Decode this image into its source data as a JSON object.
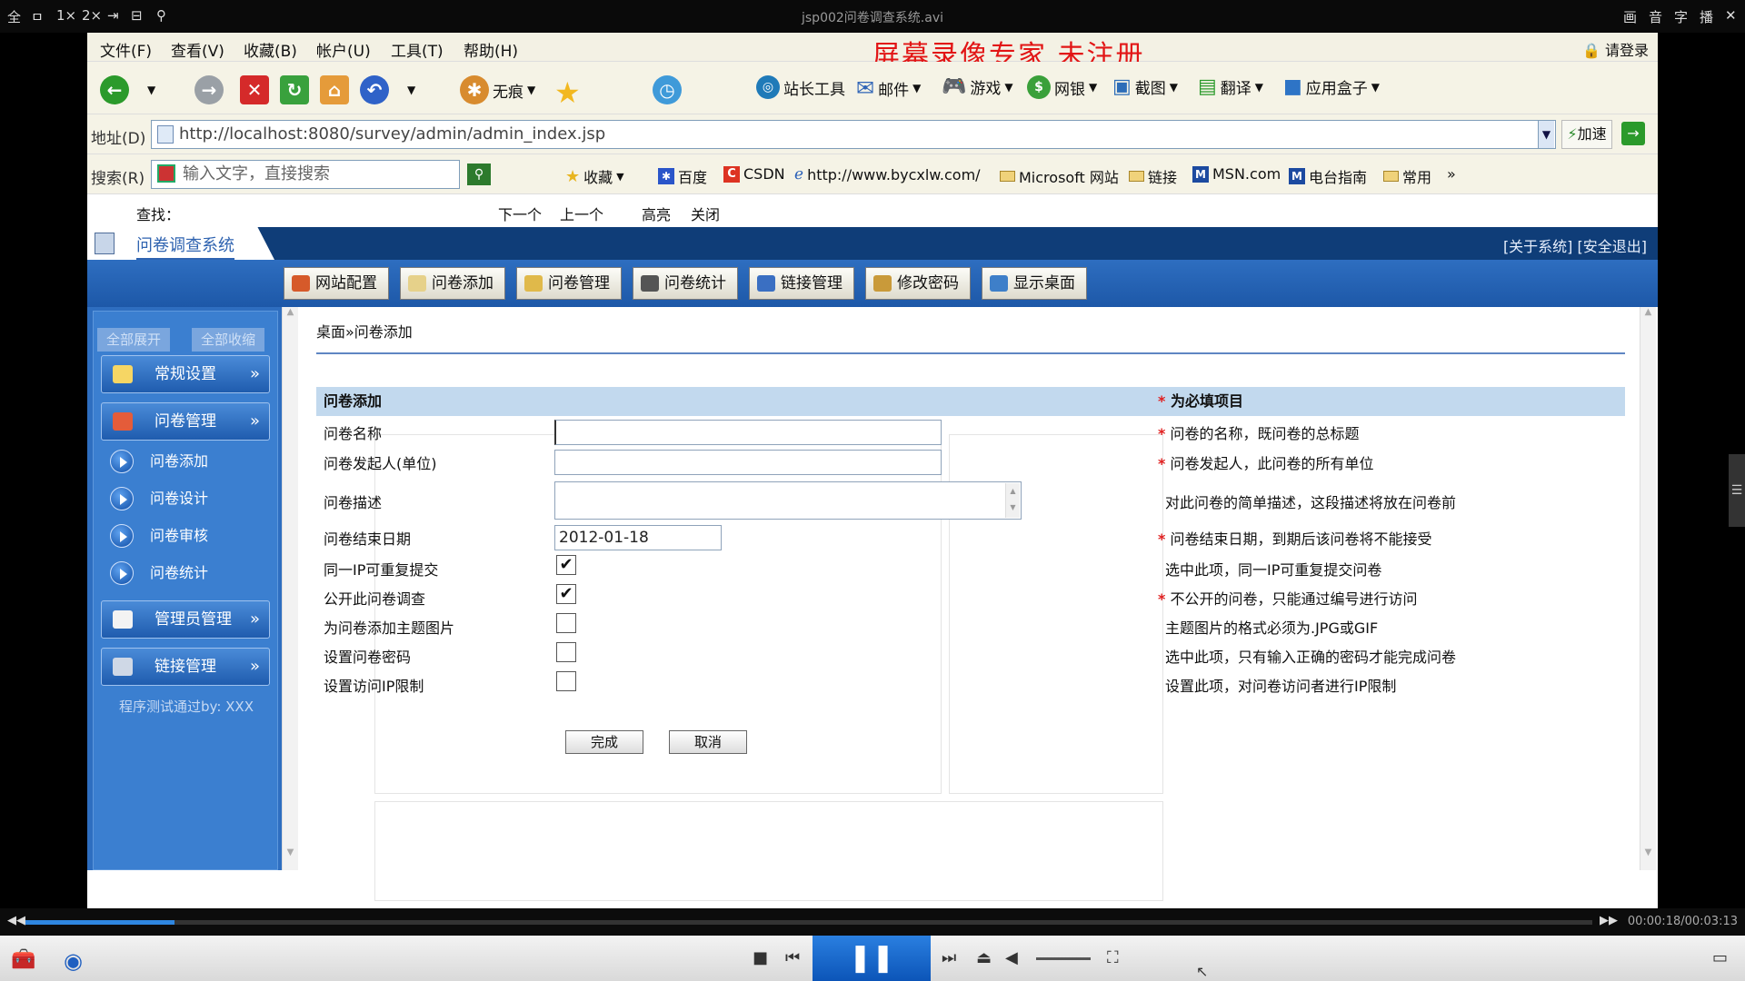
{
  "player": {
    "title": "jsp002问卷调查系统.avi",
    "left_controls": [
      "全",
      "ㅁ",
      "1×",
      "2×",
      "⇥",
      "⊟",
      "⚲"
    ],
    "right_controls": [
      "画",
      "音",
      "字",
      "播",
      "✕"
    ],
    "time": "00:00:18/00:03:13",
    "progress_fraction": 0.095
  },
  "browser": {
    "menus": [
      "文件(F)",
      "查看(V)",
      "收藏(B)",
      "帐户(U)",
      "工具(T)",
      "帮助(H)"
    ],
    "watermark": "屏幕录像专家   未注册",
    "login": "请登录",
    "toolbar": {
      "incognito": "无痕",
      "webmaster": "站长工具",
      "mail": "邮件",
      "games": "游戏",
      "netbank": "网银",
      "screenshot": "截图",
      "translate": "翻译",
      "appbox": "应用盒子"
    },
    "address_label": "地址(D)",
    "url": "http://localhost:8080/survey/admin/admin_index.jsp",
    "speedup": "加速",
    "search_label": "搜索(R)",
    "search_placeholder": "输入文字，直接搜索",
    "favorites": [
      "收藏",
      "百度",
      "CSDN",
      "http://www.bycxlw.com/",
      "Microsoft 网站",
      "链接",
      "MSN.com",
      "电台指南",
      "常用"
    ],
    "more": "»",
    "find": {
      "label": "查找：",
      "next": "下一个",
      "prev": "上一个",
      "highlight": "高亮",
      "close": "关闭"
    }
  },
  "app": {
    "title": "问卷调查系统",
    "header_links": "[关于系统] [安全退出]",
    "nav": [
      "网站配置",
      "问卷添加",
      "问卷管理",
      "问卷统计",
      "链接管理",
      "修改密码",
      "显示桌面"
    ],
    "sidebar": {
      "expand_all": "全部展开",
      "collapse_all": "全部收缩",
      "sections": [
        "常规设置",
        "问卷管理",
        "管理员管理",
        "链接管理"
      ],
      "items": [
        "问卷添加",
        "问卷设计",
        "问卷审核",
        "问卷统计"
      ],
      "footer": "程序测试通过by: XXX"
    },
    "breadcrumb": "桌面»问卷添加",
    "form": {
      "title": "问卷添加",
      "required_note": "为必填项目",
      "rows": [
        {
          "label": "问卷名称",
          "value": "",
          "required": true,
          "hint": "问卷的名称，既问卷的总标题"
        },
        {
          "label": "问卷发起人(单位)",
          "value": "",
          "required": true,
          "hint": "问卷发起人，此问卷的所有单位"
        },
        {
          "label": "问卷描述",
          "value": "",
          "required": false,
          "hint": "对此问卷的简单描述，这段描述将放在问卷前"
        },
        {
          "label": "问卷结束日期",
          "value": "2012-01-18",
          "required": true,
          "hint": "问卷结束日期，到期后该问卷将不能接受"
        },
        {
          "label": "同一IP可重复提交",
          "checked": true,
          "required": false,
          "hint": "选中此项，同一IP可重复提交问卷"
        },
        {
          "label": "公开此问卷调查",
          "checked": true,
          "required": true,
          "hint": "不公开的问卷，只能通过编号进行访问"
        },
        {
          "label": "为问卷添加主题图片",
          "checked": false,
          "required": false,
          "hint": "主题图片的格式必须为.JPG或GIF"
        },
        {
          "label": "设置问卷密码",
          "checked": false,
          "required": false,
          "hint": "选中此项，只有输入正确的密码才能完成问卷"
        },
        {
          "label": "设置访问IP限制",
          "checked": false,
          "required": false,
          "hint": "设置此项，对问卷访问者进行IP限制"
        }
      ],
      "submit": "完成",
      "cancel": "取消"
    }
  },
  "colors": {
    "header_blue": "#0f3d78",
    "nav_blue": "#2e6ec0",
    "form_header": "#c2d9ee",
    "required_star": "#e01f1f",
    "watermark": "#e21515"
  }
}
